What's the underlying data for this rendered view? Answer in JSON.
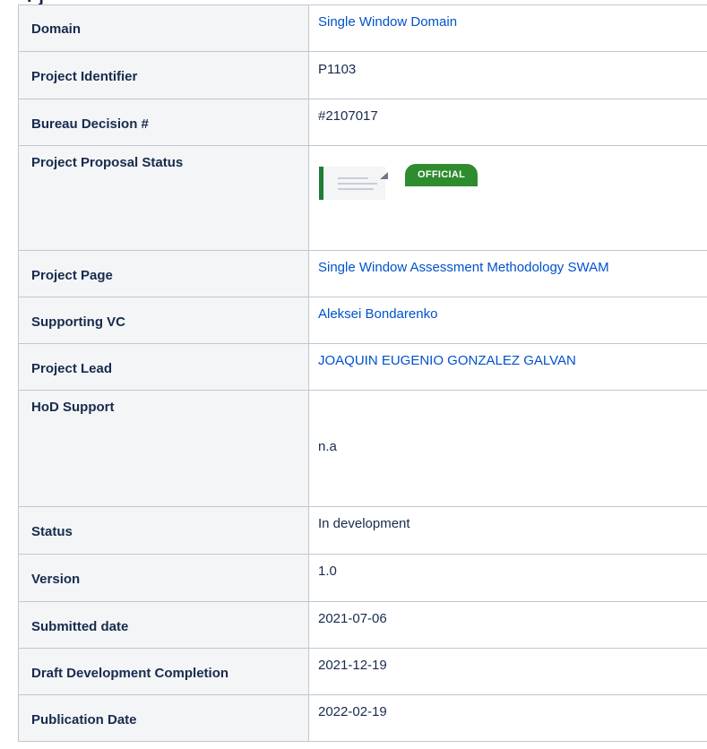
{
  "rows": [
    {
      "label": "Domain",
      "value": "Single Window Domain",
      "kind": "link"
    },
    {
      "label": "Project Identifier",
      "value": "P1103",
      "kind": "text"
    },
    {
      "label": "Bureau Decision #",
      "value": "#2107017",
      "kind": "text"
    },
    {
      "label": "Project Proposal Status",
      "badge": "OFFICIAL",
      "kind": "status"
    },
    {
      "label": "Project Page",
      "value": "Single Window Assessment Methodology SWAM",
      "kind": "link"
    },
    {
      "label": "Supporting VC",
      "value": "Aleksei Bondarenko",
      "kind": "link"
    },
    {
      "label": "Project Lead",
      "value": "JOAQUIN EUGENIO GONZALEZ GALVAN",
      "kind": "link"
    },
    {
      "label": "HoD Support",
      "value": "n.a",
      "kind": "text"
    },
    {
      "label": "Status",
      "value": "In development",
      "kind": "text"
    },
    {
      "label": "Version",
      "value": "1.0",
      "kind": "text"
    },
    {
      "label": "Submitted date",
      "value": "2021-07-06",
      "kind": "text"
    },
    {
      "label": "Draft Development Completion",
      "value": "2021-12-19",
      "kind": "text"
    },
    {
      "label": "Publication Date",
      "value": "2022-02-19",
      "kind": "text"
    }
  ],
  "colors": {
    "link": "#0052cc",
    "badge_bg": "#2e8b2e",
    "status_bar": "#1e7e34",
    "header_bg": "#f4f5f7",
    "border": "#c1c7d0"
  }
}
